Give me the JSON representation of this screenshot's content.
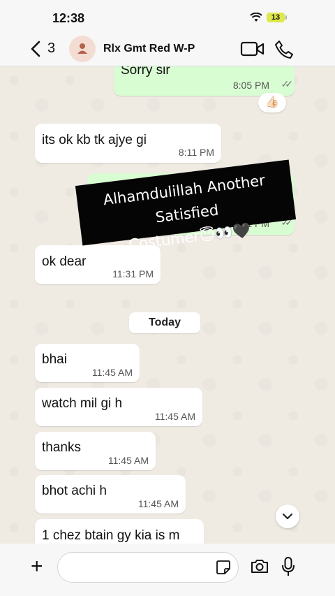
{
  "status": {
    "time": "12:38",
    "battery": "13"
  },
  "header": {
    "back_count": "3",
    "contact_name": "Rlx Gmt Red W-P"
  },
  "messages": [
    {
      "text": "Sorry sir",
      "time": "8:05 PM"
    },
    {
      "text": "its ok kb tk ajye gi",
      "time": "8:11 PM"
    },
    {
      "text": "",
      "time": "9:11 PM"
    },
    {
      "text": "ok dear",
      "time": "11:31 PM"
    },
    {
      "text": "bhai",
      "time": "11:45 AM"
    },
    {
      "text": "watch mil gi h",
      "time": "11:45 AM"
    },
    {
      "text": "thanks",
      "time": "11:45 AM"
    },
    {
      "text": "bhot achi h",
      "time": "11:45 AM"
    },
    {
      "text": "1 chez btain gy kia is m",
      "time": ""
    }
  ],
  "reaction": "👍🏻",
  "date_separator": "Today",
  "overlay": {
    "line1": "Alhamdulillah Another Satisfied",
    "line2": "Costumer😇👀🖤"
  },
  "composer": {
    "placeholder": ""
  }
}
